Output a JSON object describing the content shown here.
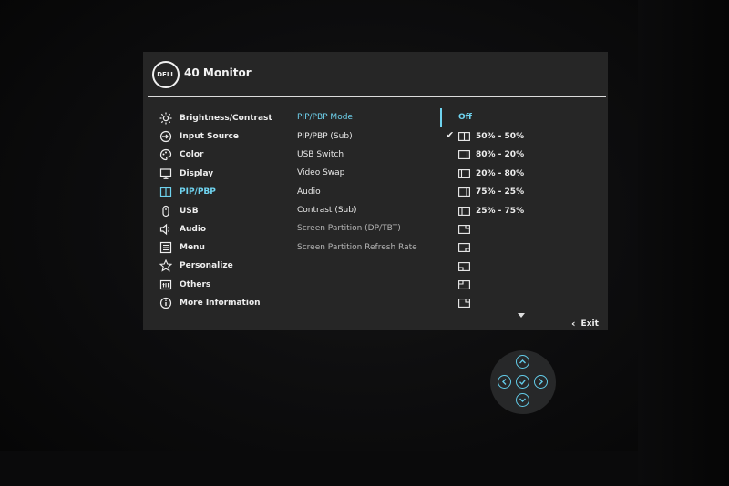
{
  "header": {
    "logo_text": "DELL",
    "title": "40 Monitor"
  },
  "menu": [
    {
      "label": "Brightness/Contrast",
      "icon": "brightness-icon"
    },
    {
      "label": "Input Source",
      "icon": "input-source-icon"
    },
    {
      "label": "Color",
      "icon": "color-palette-icon"
    },
    {
      "label": "Display",
      "icon": "display-icon"
    },
    {
      "label": "PIP/PBP",
      "icon": "pip-pbp-icon",
      "active": true
    },
    {
      "label": "USB",
      "icon": "usb-icon"
    },
    {
      "label": "Audio",
      "icon": "speaker-icon"
    },
    {
      "label": "Menu",
      "icon": "menu-icon"
    },
    {
      "label": "Personalize",
      "icon": "star-icon"
    },
    {
      "label": "Others",
      "icon": "others-icon"
    },
    {
      "label": "More Information",
      "icon": "info-icon"
    }
  ],
  "submenu": [
    {
      "label": "PIP/PBP Mode",
      "state": "active"
    },
    {
      "label": "PIP/PBP (Sub)",
      "state": "normal"
    },
    {
      "label": "USB Switch",
      "state": "normal"
    },
    {
      "label": "Video Swap",
      "state": "normal"
    },
    {
      "label": "Audio",
      "state": "normal"
    },
    {
      "label": "Contrast (Sub)",
      "state": "normal"
    },
    {
      "label": "Screen Partition (DP/TBT)",
      "state": "dim"
    },
    {
      "label": "Screen Partition Refresh Rate",
      "state": "dim"
    }
  ],
  "options": {
    "current": "Off",
    "ratios": [
      {
        "label": "50% - 50%",
        "selected": true,
        "icon": "split-50-50-icon"
      },
      {
        "label": "80% - 20%",
        "icon": "split-80-20-icon"
      },
      {
        "label": "20% - 80%",
        "icon": "split-20-80-icon"
      },
      {
        "label": "75% - 25%",
        "icon": "split-75-25-icon"
      },
      {
        "label": "25% - 75%",
        "icon": "split-25-75-icon"
      }
    ],
    "pip_positions": [
      "pip-top-right-icon",
      "pip-bottom-right-icon",
      "pip-bottom-left-icon",
      "pip-top-left-icon",
      "pip-top-right-icon"
    ]
  },
  "footer": {
    "exit_label": "Exit"
  },
  "colors": {
    "accent": "#6fd3ef",
    "panel": "#262626",
    "text": "#ededed"
  }
}
